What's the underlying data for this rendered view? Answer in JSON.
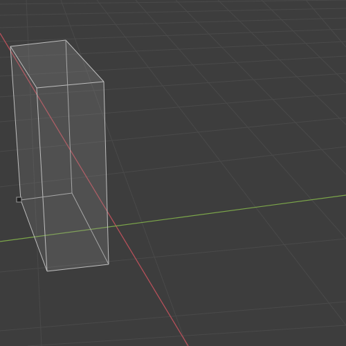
{
  "viewport": {
    "view": "3D Viewport",
    "background_color": "#3d3d3d",
    "grid": {
      "visible": true,
      "line_color": "#4a4a4a",
      "x_axis_color": "#b7505a",
      "y_axis_color": "#7da84a"
    },
    "object": {
      "type": "box-mesh",
      "display": "x-ray",
      "fill_color": "#8e8e8e",
      "edge_color": "#bfbfbf"
    },
    "object_origin_visible": true
  }
}
